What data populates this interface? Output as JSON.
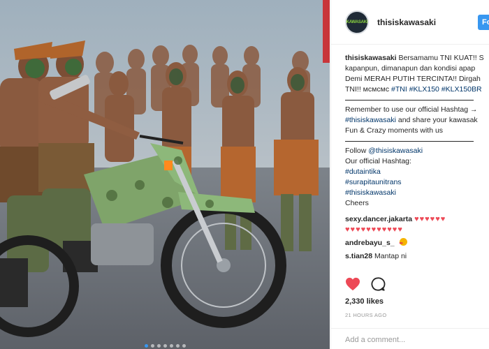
{
  "account": {
    "avatar_text": "KAWASAKI",
    "username": "thisiskawasaki",
    "follow_label": "Follow"
  },
  "caption": {
    "line1_user": "thisiskawasaki",
    "line1_text": "Bersamamu TNI KUAT!! S",
    "line2": "kapanpun, dimanapun dan kondisi apap",
    "line3": "Demi MERAH PUTIH TERCINTA!! Dirgah",
    "line4_text": "TNI!! мсмсмс ",
    "line4_tags": "#TNI #KLX150 #KLX150BR",
    "reminder1": "Remember to use our official Hashtag →",
    "reminder2_tag": "#thisiskawasaki",
    "reminder2_text": " and share your kawasak",
    "reminder3": "Fun & Crazy moments with us",
    "follow_prefix": "Follow ",
    "follow_handle": "@thisiskawasaki",
    "hashtag_heading": "Our official Hashtag:",
    "tag1": "#dutaintika",
    "tag2": "#surapitaunitrans",
    "tag3": "#thisiskawasaki",
    "cheers": "Cheers"
  },
  "comments": [
    {
      "user": "sexy.dancer.jakarta",
      "text": ""
    },
    {
      "user": "andrebayu_s_",
      "text": ""
    },
    {
      "user": "s.tian28",
      "text": "Mantap ni"
    }
  ],
  "hearts_row1": "♥♥♥♥♥♥",
  "hearts_row2": "♥♥♥♥♥♥♥♥♥♥♥",
  "likes": "2,330 likes",
  "timestamp": "21 HOURS AGO",
  "add_comment_placeholder": "Add a comment...",
  "colors": {
    "accent_blue": "#3897f0",
    "heart_red": "#ed4956",
    "link_navy": "#003569"
  },
  "icons": [
    "heart-icon",
    "comment-icon"
  ],
  "carousel": {
    "count": 7,
    "active_index": 0
  }
}
